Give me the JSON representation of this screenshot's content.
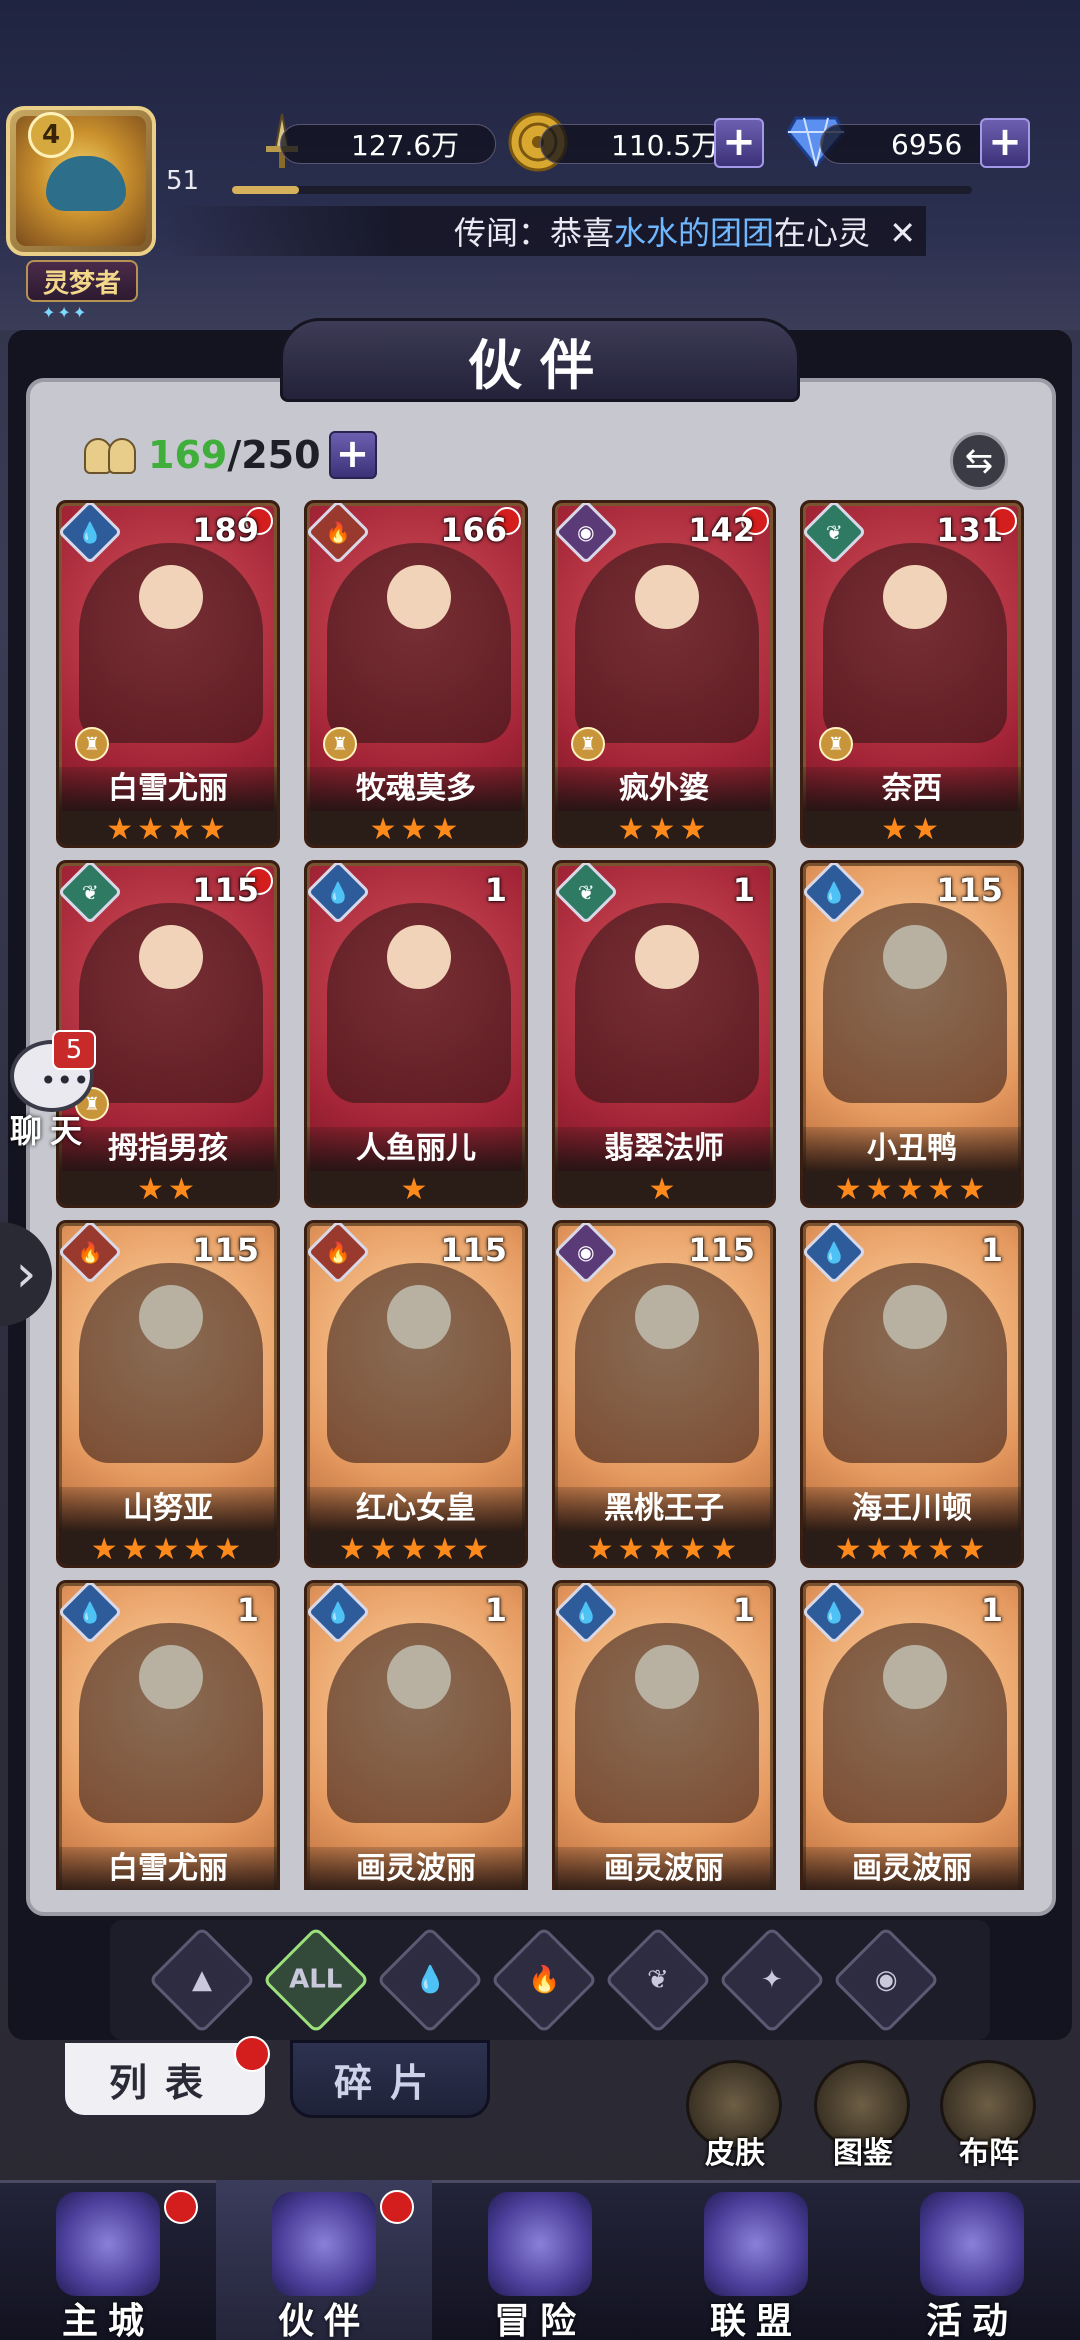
{
  "player": {
    "level": "4",
    "exp_value": "51",
    "exp_progress": 0.09,
    "title": "灵梦者",
    "title_stars": "✦✦✦"
  },
  "resources": {
    "power": "127.6万",
    "gold": "110.5万",
    "gems": "6956"
  },
  "rumor": {
    "prefix": "传闻：恭喜",
    "highlight": "水水的团团",
    "suffix": "在心灵"
  },
  "panel": {
    "title": "伙伴",
    "count_current": "169",
    "count_max": "/250"
  },
  "cards": [
    {
      "name": "白雪尤丽",
      "level": "189",
      "element": "water",
      "stars": "★★★★",
      "bg": "red",
      "dot": true,
      "rank": true
    },
    {
      "name": "牧魂莫多",
      "level": "166",
      "element": "fire",
      "stars": "★★★",
      "bg": "red",
      "dot": true,
      "rank": true
    },
    {
      "name": "疯外婆",
      "level": "142",
      "element": "dark",
      "stars": "★★★",
      "bg": "red",
      "dot": true,
      "rank": true
    },
    {
      "name": "奈西",
      "level": "131",
      "element": "nature",
      "stars": "★★",
      "bg": "red",
      "dot": true,
      "rank": true
    },
    {
      "name": "拇指男孩",
      "level": "115",
      "element": "nature",
      "stars": "★★",
      "bg": "red",
      "dot": true,
      "rank": true
    },
    {
      "name": "人鱼丽儿",
      "level": "1",
      "element": "water",
      "stars": "★",
      "bg": "red",
      "dot": false,
      "rank": false
    },
    {
      "name": "翡翠法师",
      "level": "1",
      "element": "nature",
      "stars": "★",
      "bg": "red",
      "dot": false,
      "rank": false
    },
    {
      "name": "小丑鸭",
      "level": "115",
      "element": "water",
      "stars": "★★★★★",
      "bg": "orange",
      "dot": false,
      "rank": false
    },
    {
      "name": "山努亚",
      "level": "115",
      "element": "fire",
      "stars": "★★★★★",
      "bg": "orange",
      "dot": false,
      "rank": false
    },
    {
      "name": "红心女皇",
      "level": "115",
      "element": "fire",
      "stars": "★★★★★",
      "bg": "orange",
      "dot": false,
      "rank": false
    },
    {
      "name": "黑桃王子",
      "level": "115",
      "element": "dark",
      "stars": "★★★★★",
      "bg": "orange",
      "dot": false,
      "rank": false
    },
    {
      "name": "海王川顿",
      "level": "1",
      "element": "water",
      "stars": "★★★★★",
      "bg": "orange",
      "dot": false,
      "rank": false
    },
    {
      "name": "白雪尤丽",
      "level": "1",
      "element": "water",
      "stars": "",
      "bg": "orange",
      "dot": false,
      "rank": false
    },
    {
      "name": "画灵波丽",
      "level": "1",
      "element": "water",
      "stars": "",
      "bg": "orange",
      "dot": false,
      "rank": false
    },
    {
      "name": "画灵波丽",
      "level": "1",
      "element": "water",
      "stars": "",
      "bg": "orange",
      "dot": false,
      "rank": false
    },
    {
      "name": "画灵波丽",
      "level": "1",
      "element": "water",
      "stars": "",
      "bg": "orange",
      "dot": false,
      "rank": false
    }
  ],
  "filters": [
    {
      "label": "▲",
      "name": "filter-wind-icon"
    },
    {
      "label": "ALL",
      "name": "filter-all",
      "active": true
    },
    {
      "label": "💧",
      "name": "filter-water-icon"
    },
    {
      "label": "🔥",
      "name": "filter-fire-icon"
    },
    {
      "label": "❦",
      "name": "filter-nature-icon"
    },
    {
      "label": "✦",
      "name": "filter-light-icon"
    },
    {
      "label": "◉",
      "name": "filter-dark-icon"
    }
  ],
  "tabs": {
    "list": "列表",
    "shards": "碎片"
  },
  "side_buttons": {
    "skin": "皮肤",
    "codex": "图鉴",
    "formation": "布阵"
  },
  "chat": {
    "badge": "5",
    "label": "聊天"
  },
  "nav": {
    "city": "主城",
    "partners": "伙伴",
    "adventure": "冒险",
    "alliance": "联盟",
    "events": "活动"
  },
  "colors": {
    "accent_purple": "#4c3f9b",
    "count_green": "#3fae3a",
    "star_orange": "#ff8a1c",
    "notify_red": "#d41d1d",
    "rumor_highlight": "#6fb8ff"
  }
}
